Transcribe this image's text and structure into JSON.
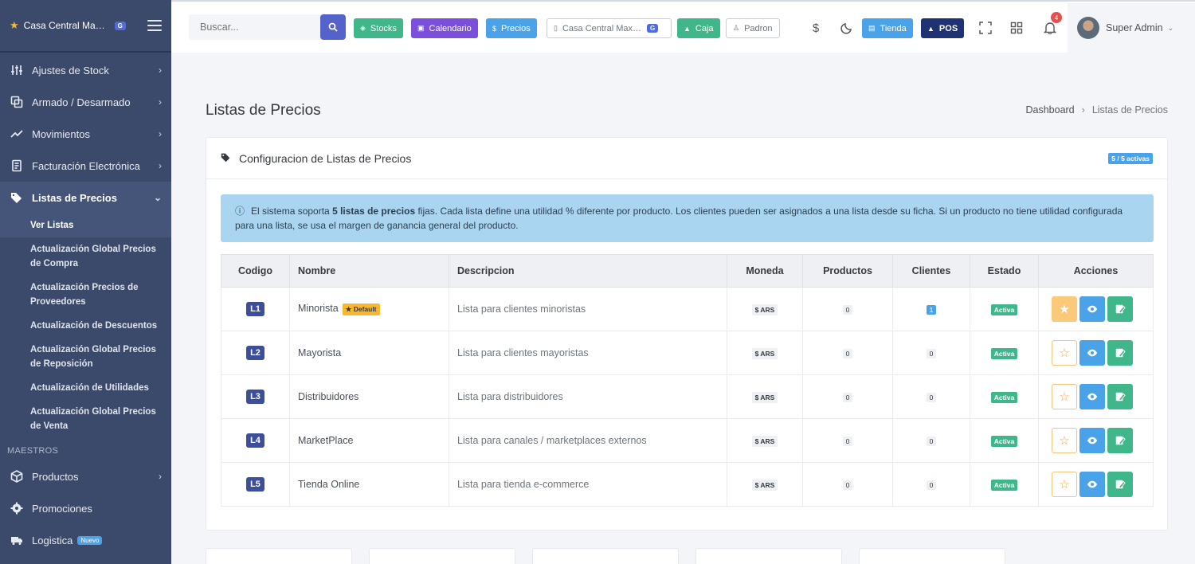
{
  "brand": {
    "name": "Casa Central Maxik...",
    "badge": "G"
  },
  "sidebar": {
    "items": [
      {
        "label": "Ajustes de Stock",
        "icon": "sliders-icon"
      },
      {
        "label": "Armado / Desarmado",
        "icon": "copy-icon"
      },
      {
        "label": "Movimientos",
        "icon": "trend-icon"
      },
      {
        "label": "Facturación Electrónica",
        "icon": "invoice-icon"
      },
      {
        "label": "Listas de Precios",
        "icon": "tags-icon"
      }
    ],
    "subitems": [
      "Ver Listas",
      "Actualización Global Precios de Compra",
      "Actualización Precios de Proveedores",
      "Actualización de Descuentos",
      "Actualización Global Precios de Reposición",
      "Actualización de Utilidades",
      "Actualización Global Precios de Venta"
    ],
    "section_label": "MAESTROS",
    "maestros": [
      {
        "label": "Productos",
        "icon": "box-icon"
      },
      {
        "label": "Promociones",
        "icon": "gear-icon"
      },
      {
        "label": "Logistica",
        "icon": "truck-icon",
        "badge": "Nuevo"
      }
    ]
  },
  "topbar": {
    "search_placeholder": "Buscar...",
    "buttons": {
      "stocks": "Stocks",
      "calendario": "Calendario",
      "precios": "Precios",
      "sucursal": "Casa Central Maxik...",
      "sucursal_badge": "G",
      "caja": "Caja",
      "padron": "Padron",
      "tienda": "Tienda",
      "pos": "POS"
    },
    "notification_count": "4",
    "user_name": "Super Admin"
  },
  "page": {
    "title": "Listas de Precios",
    "breadcrumb": {
      "home": "Dashboard",
      "current": "Listas de Precios"
    }
  },
  "card": {
    "title": "Configuracion de Listas de Precios",
    "active_badge": "5 / 5 activas",
    "alert": {
      "pre": "El sistema soporta ",
      "bold": "5 listas de precios",
      "post": " fijas. Cada lista define una utilidad % diferente por producto. Los clientes pueden ser asignados a una lista desde su ficha. Si un producto no tiene utilidad configurada para una lista, se usa el margen de ganancia general del producto."
    }
  },
  "table": {
    "headers": {
      "codigo": "Codigo",
      "nombre": "Nombre",
      "descripcion": "Descripcion",
      "moneda": "Moneda",
      "productos": "Productos",
      "clientes": "Clientes",
      "estado": "Estado",
      "acciones": "Acciones"
    },
    "default_label": "★ Default",
    "rows": [
      {
        "code": "L1",
        "name": "Minorista",
        "desc": "Lista para clientes minoristas",
        "currency": "$ ARS",
        "products": "0",
        "clients": "1",
        "status": "Activa"
      },
      {
        "code": "L2",
        "name": "Mayorista",
        "desc": "Lista para clientes mayoristas",
        "currency": "$ ARS",
        "products": "0",
        "clients": "0",
        "status": "Activa"
      },
      {
        "code": "L3",
        "name": "Distribuidores",
        "desc": "Lista para distribuidores",
        "currency": "$ ARS",
        "products": "0",
        "clients": "0",
        "status": "Activa"
      },
      {
        "code": "L4",
        "name": "MarketPlace",
        "desc": "Lista para canales / marketplaces externos",
        "currency": "$ ARS",
        "products": "0",
        "clients": "0",
        "status": "Activa"
      },
      {
        "code": "L5",
        "name": "Tienda Online",
        "desc": "Lista para tienda e-commerce",
        "currency": "$ ARS",
        "products": "0",
        "clients": "0",
        "status": "Activa"
      }
    ]
  },
  "colors": {
    "sidebar": "#3b4a6b",
    "primary": "#5463c9",
    "success": "#3fb78a",
    "info": "#4aa3e8",
    "warning": "#f7b731"
  }
}
